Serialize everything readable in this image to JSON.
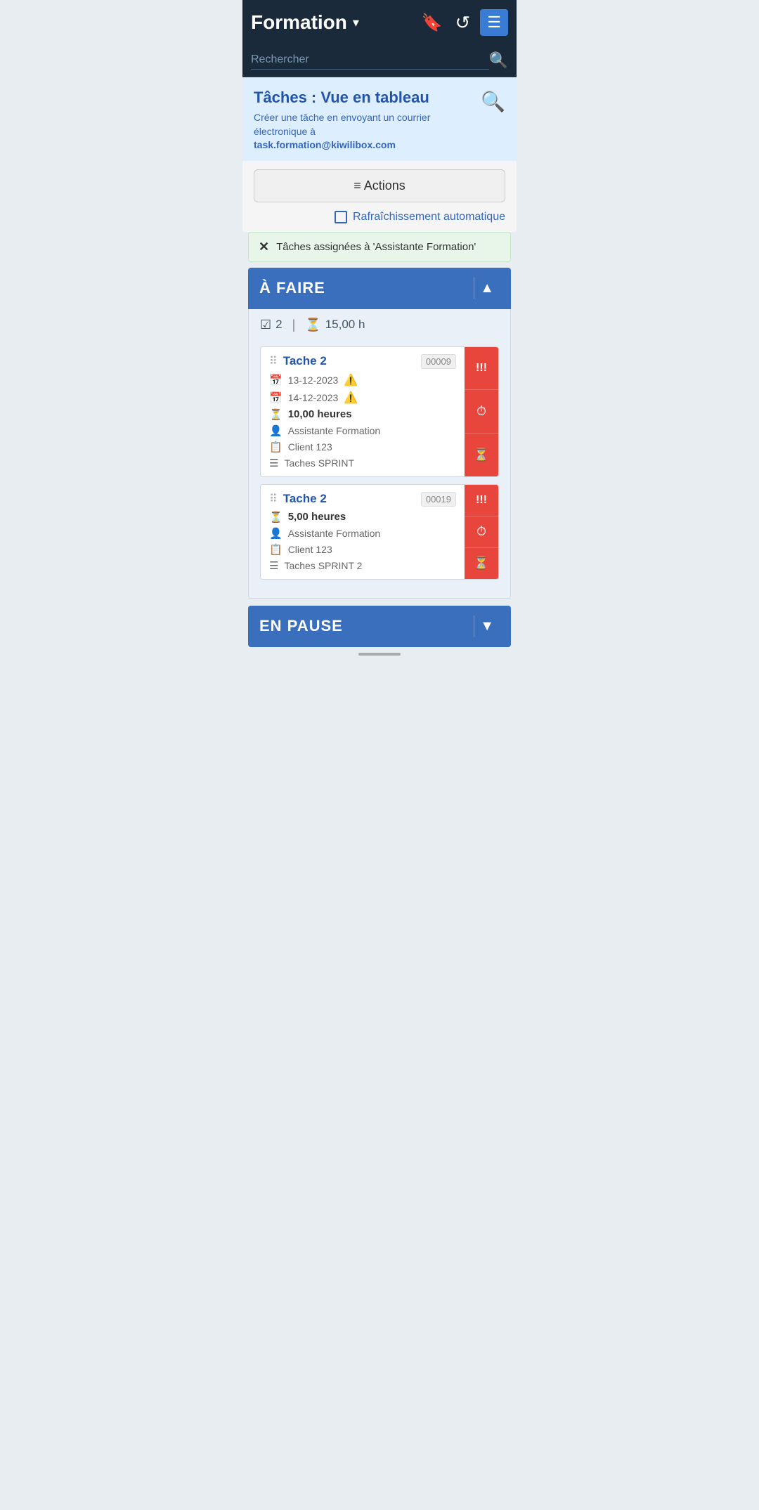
{
  "header": {
    "title": "Formation",
    "dropdown_arrow": "▾",
    "bookmark_icon": "🔖",
    "history_icon": "↺",
    "menu_icon": "☰"
  },
  "search": {
    "placeholder": "Rechercher",
    "icon": "🔍"
  },
  "board": {
    "title": "Tâches : Vue en tableau",
    "subtitle": "Créer une tâche en envoyant un courrier électronique à",
    "email": "task.formation@kiwilibox.com",
    "search_icon": "🔍"
  },
  "actions": {
    "label": "≡ Actions"
  },
  "auto_refresh": {
    "label": "Rafraîchissement automatique"
  },
  "filter": {
    "close": "✕",
    "text": "Tâches assignées à 'Assistante Formation'"
  },
  "section_todo": {
    "title": "À FAIRE",
    "toggle": "▲",
    "stats": {
      "check_icon": "☑",
      "count": "2",
      "separator": "|",
      "time_icon": "⏳",
      "hours": "15,00 h"
    }
  },
  "tasks": [
    {
      "drag_handle": "⠿",
      "title": "Tache 2",
      "id": "00009",
      "date1": "13-12-2023",
      "date1_warning": "⚠",
      "date1_icon": "📅",
      "date2": "14-12-2023",
      "date2_warning": "🔴⚠",
      "date2_icon": "📅",
      "hours": "10,00 heures",
      "hours_icon": "⏳",
      "assignee": "Assistante Formation",
      "assignee_icon": "👤",
      "client": "Client 123",
      "client_icon": "📋",
      "project": "Taches SPRINT",
      "project_icon": "☰",
      "side_buttons": [
        "!!!",
        "⏱",
        "⏳"
      ]
    },
    {
      "drag_handle": "⠿",
      "title": "Tache 2",
      "id": "00019",
      "date1": null,
      "date2": null,
      "hours": "5,00 heures",
      "hours_icon": "⏳",
      "assignee": "Assistante Formation",
      "assignee_icon": "👤",
      "client": "Client 123",
      "client_icon": "📋",
      "project": "Taches SPRINT 2",
      "project_icon": "☰",
      "side_buttons": [
        "!!!",
        "⏱",
        "⏳"
      ]
    }
  ],
  "section_pause": {
    "title": "EN PAUSE",
    "toggle": "▼"
  },
  "colors": {
    "primary_blue": "#3a6fbe",
    "dark_nav": "#1a2a3a",
    "accent_red": "#e8453c",
    "light_blue_bg": "#ddeeff",
    "text_blue": "#2255aa"
  }
}
